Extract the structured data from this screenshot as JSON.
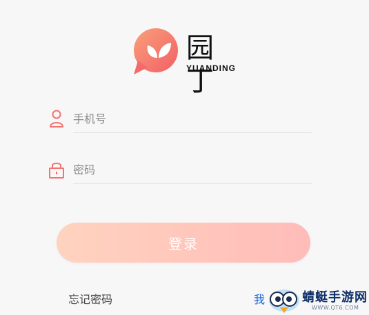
{
  "logo": {
    "name_cn": "园丁",
    "name_en": "YUANDING"
  },
  "form": {
    "phone": {
      "placeholder": "手机号",
      "value": ""
    },
    "password": {
      "placeholder": "密码",
      "value": ""
    },
    "login_label": "登录"
  },
  "links": {
    "forgot_password": "忘记密码",
    "right_link_partial": "我"
  },
  "watermark": {
    "title": "蜻蜓手游网",
    "url": "WWW.QT6.COM"
  },
  "colors": {
    "accent": "#f4736f",
    "button_start": "#ffd3bf",
    "button_end": "#ffbcb9",
    "link_blue": "#1763d6"
  },
  "icons": {
    "logo": "leaf-speech-bubble-icon",
    "phone_field": "user-icon",
    "password_field": "lock-icon"
  }
}
